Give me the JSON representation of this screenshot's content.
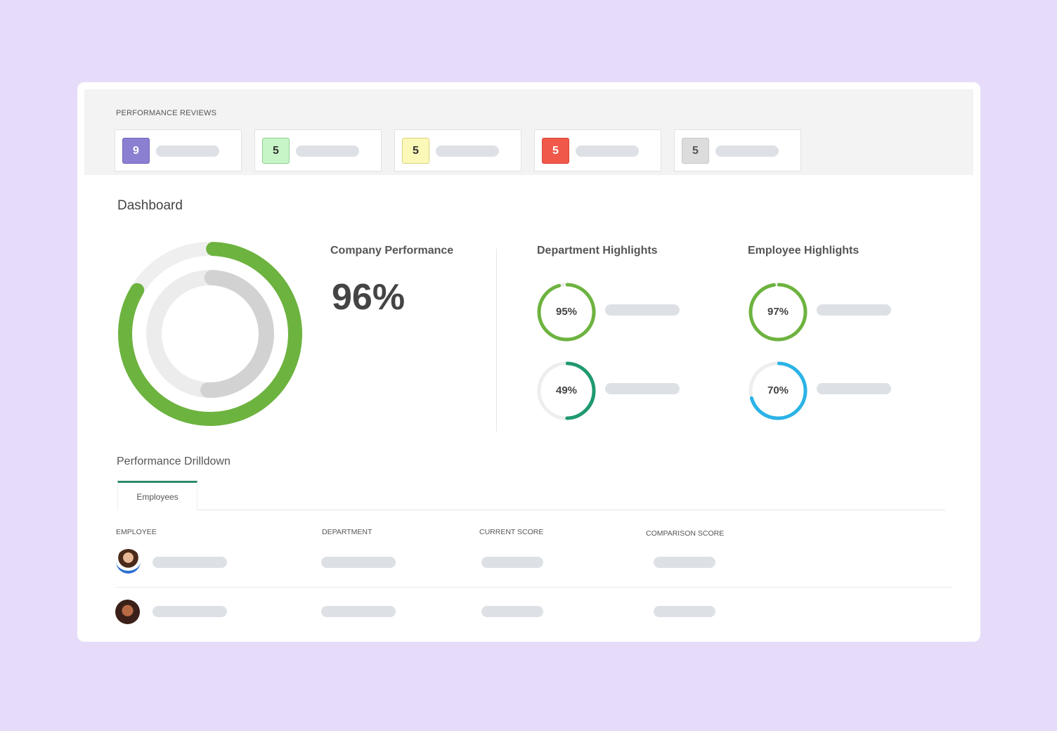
{
  "reviews": {
    "title": "PERFORMANCE REVIEWS",
    "items": [
      {
        "count": "9",
        "bg": "#8a7fd0",
        "border": "#7468c0",
        "color": "#ffffff"
      },
      {
        "count": "5",
        "bg": "#c8f5c8",
        "border": "#8fcf8f",
        "color": "#333333"
      },
      {
        "count": "5",
        "bg": "#fbf8b8",
        "border": "#d9d37a",
        "color": "#333333"
      },
      {
        "count": "5",
        "bg": "#f0584a",
        "border": "#d84436",
        "color": "#ffffff"
      },
      {
        "count": "5",
        "bg": "#dcdcdc",
        "border": "#c8c8c8",
        "color": "#555555"
      }
    ]
  },
  "dashboard": {
    "title": "Dashboard",
    "company": {
      "title": "Company Performance",
      "value": "96%",
      "outer_fill": 0.83,
      "inner_fill": 0.5,
      "color": "#6db33f"
    },
    "department": {
      "title": "Department Highlights",
      "items": [
        {
          "value": "95%",
          "fill": 0.95,
          "color": "#6db33f"
        },
        {
          "value": "49%",
          "fill": 0.49,
          "color": "#1f9a6e"
        }
      ]
    },
    "employee": {
      "title": "Employee Highlights",
      "items": [
        {
          "value": "97%",
          "fill": 0.97,
          "color": "#6db33f"
        },
        {
          "value": "70%",
          "fill": 0.7,
          "color": "#2bb3e6"
        }
      ]
    }
  },
  "drilldown": {
    "title": "Performance Drilldown",
    "tab": "Employees",
    "columns": [
      "EMPLOYEE",
      "DEPARTMENT",
      "CURRENT SCORE",
      "COMPARISON SCORE"
    ]
  }
}
